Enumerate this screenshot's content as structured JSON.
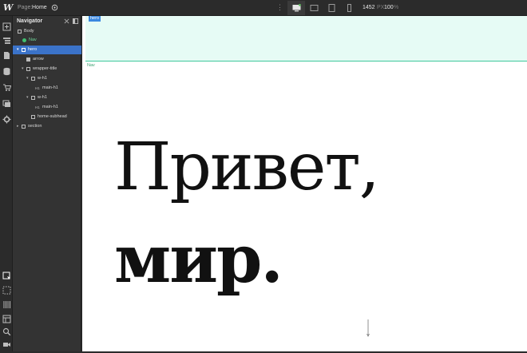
{
  "topbar": {
    "logo": "W",
    "page_label": "Page:",
    "page_value": "Home",
    "dots": "⋮",
    "width_value": "1452",
    "width_unit": "PX",
    "zoom_value": "100",
    "zoom_unit": "%"
  },
  "navigator": {
    "title": "Navigator",
    "items": [
      {
        "label": "Body"
      },
      {
        "label": "Nav"
      },
      {
        "label": "hero"
      },
      {
        "label": "arrow"
      },
      {
        "label": "wrapper-title"
      },
      {
        "label": "w-h1"
      },
      {
        "label": "main-h1",
        "tag": "H1"
      },
      {
        "label": "w-h1"
      },
      {
        "label": "main-h1",
        "tag": "H1"
      },
      {
        "label": "home-subhead"
      },
      {
        "label": "section"
      }
    ]
  },
  "canvas": {
    "hero_tag": "hero",
    "nav_tag": "Nav",
    "headline_line1": "Привет,",
    "headline_line2": "мир."
  },
  "colors": {
    "selection": "#3b73c9",
    "hero_band": "#e6fbf5",
    "hero_border": "#3ec79c",
    "hero_tag": "#3b88e0"
  }
}
